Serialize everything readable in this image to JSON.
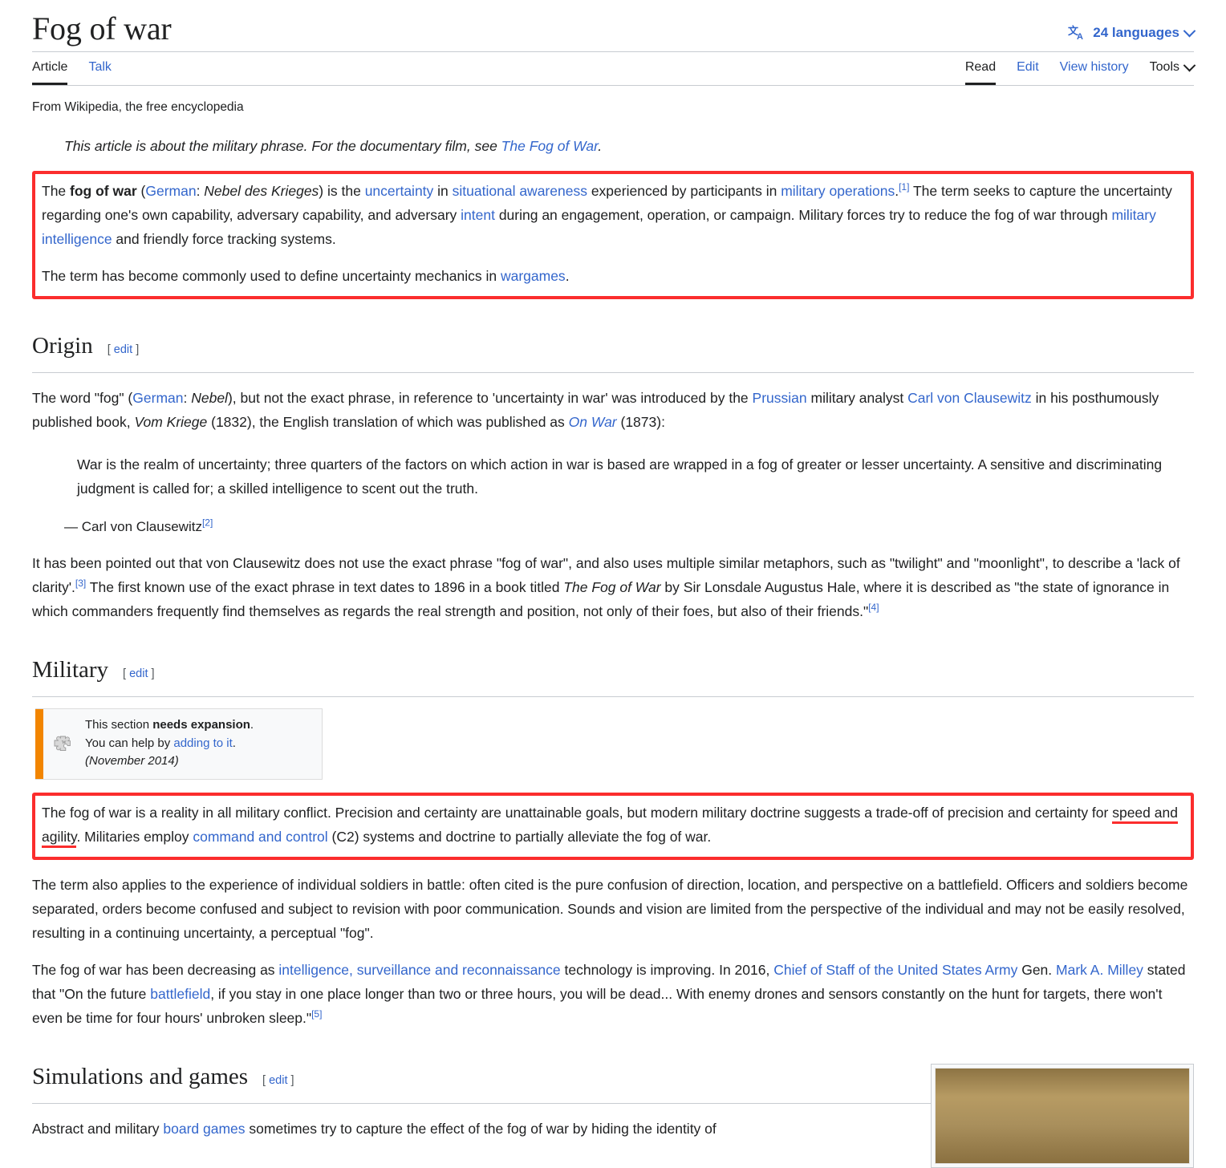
{
  "header": {
    "title": "Fog of war",
    "languages_label": "24 languages",
    "languages_icon": "language-translate-icon",
    "tabs_left": [
      {
        "label": "Article",
        "selected": true
      },
      {
        "label": "Talk",
        "selected": false
      }
    ],
    "tabs_right": [
      {
        "label": "Read",
        "selected": true
      },
      {
        "label": "Edit",
        "selected": false
      },
      {
        "label": "View history",
        "selected": false
      }
    ],
    "tools_label": "Tools"
  },
  "site_sub": "From Wikipedia, the free encyclopedia",
  "hatnote": {
    "text_before": "This article is about the military phrase. For the documentary film, see ",
    "link": "The Fog of War",
    "text_after": "."
  },
  "lead": {
    "p1": {
      "s1": "The ",
      "bold": "fog of war",
      "s2": " (",
      "link_german": "German",
      "s3": ": ",
      "italic_german": "Nebel des Krieges",
      "s4": ") is the ",
      "link_uncertainty": "uncertainty",
      "s5": " in ",
      "link_sa": "situational awareness",
      "s6": " experienced by participants in ",
      "link_milops": "military operations",
      "s7": ".",
      "ref1": "[1]",
      "s8": " The term seeks to capture the uncertainty regarding one's own capability, adversary capability, and adversary ",
      "link_intent": "intent",
      "s9": " during an engagement, operation, or campaign. Military forces try to reduce the fog of war through ",
      "link_milint": "military intelligence",
      "s10": " and friendly force tracking systems."
    },
    "p2": {
      "s1": "The term has become commonly used to define uncertainty mechanics in ",
      "link_wargames": "wargames",
      "s2": "."
    }
  },
  "origin": {
    "heading": "Origin",
    "edit_bracket_open": "[",
    "edit_label": "edit",
    "edit_bracket_close": "]",
    "p1": {
      "s1": "The word \"fog\" (",
      "link_german": "German",
      "s2": ": ",
      "italic_nebel": "Nebel",
      "s3": "), but not the exact phrase, in reference to 'uncertainty in war' was introduced by the ",
      "link_prussian": "Prussian",
      "s4": " military analyst ",
      "link_clausewitz": "Carl von Clausewitz",
      "s5": " in his posthumously published book, ",
      "italic_vomkriege": "Vom Kriege",
      "s6": " (1832), the English translation of which was published as ",
      "link_onwar": "On War",
      "s7": " (1873):"
    },
    "quote": "War is the realm of uncertainty; three quarters of the factors on which action in war is based are wrapped in a fog of greater or lesser uncertainty. A sensitive and discriminating judgment is called for; a skilled intelligence to scent out the truth.",
    "attrib": "— Carl von Clausewitz",
    "attrib_ref": "[2]",
    "p2": {
      "s1": "It has been pointed out that von Clausewitz does not use the exact phrase \"fog of war\", and also uses multiple similar metaphors, such as \"twilight\" and \"moonlight\", to describe a 'lack of clarity'.",
      "ref3": "[3]",
      "s2": " The first known use of the exact phrase in text dates to 1896 in a book titled ",
      "italic_fow": "The Fog of War",
      "s3": " by Sir Lonsdale Augustus Hale, where it is described as \"the state of ignorance in which commanders frequently find themselves as regards the real strength and position, not only of their foes, but also of their friends.\"",
      "ref4": "[4]"
    }
  },
  "military": {
    "heading": "Military",
    "edit_bracket_open": "[",
    "edit_label": "edit",
    "edit_bracket_close": "]",
    "ambox": {
      "icon": "puzzle-piece-icon",
      "line1_pre": "This section ",
      "line1_bold": "needs expansion",
      "line1_post": ".",
      "line2_pre": "You can help by ",
      "line2_link": "adding to it",
      "line2_post": ".",
      "date": "(November 2014)",
      "accent_color": "#f28500"
    },
    "p1": {
      "s1": "The fog of war is a reality in all military conflict. Precision and certainty are unattainable goals, but modern military doctrine suggests a trade-off of precision and certainty for ",
      "underlined": "speed and agility",
      "s2": ". Militaries employ ",
      "link_c2": "command and control",
      "s3": " (C2) systems and doctrine to partially alleviate the fog of war."
    },
    "p2": "The term also applies to the experience of individual soldiers in battle: often cited is the pure confusion of direction, location, and perspective on a battlefield. Officers and soldiers become separated, orders become confused and subject to revision with poor communication. Sounds and vision are limited from the perspective of the individual and may not be easily resolved, resulting in a continuing uncertainty, a perceptual \"fog\".",
    "p3": {
      "s1": "The fog of war has been decreasing as ",
      "link_isr": "intelligence, surveillance and reconnaissance",
      "s2": " technology is improving. In 2016, ",
      "link_chief": "Chief of Staff of the United States Army",
      "s3": " Gen. ",
      "link_milley": "Mark A. Milley",
      "s4": " stated that \"On the future ",
      "link_battlefield": "battlefield",
      "s5": ", if you stay in one place longer than two or three hours, you will be dead... With enemy drones and sensors constantly on the hunt for targets, there won't even be time for four hours' unbroken sleep.\"",
      "ref5": "[5]"
    }
  },
  "simulations": {
    "heading": "Simulations and games",
    "edit_bracket_open": "[",
    "edit_label": "edit",
    "edit_bracket_close": "]",
    "p1": {
      "s1": "Abstract and military ",
      "link_board": "board games",
      "s2": " sometimes try to capture the effect of the fog of war by hiding the identity of"
    }
  },
  "colors": {
    "link": "#3366cc",
    "text": "#202122",
    "highlight_red": "#fb2d2d",
    "ambox_orange": "#f28500",
    "rule": "#c8ccd1"
  }
}
